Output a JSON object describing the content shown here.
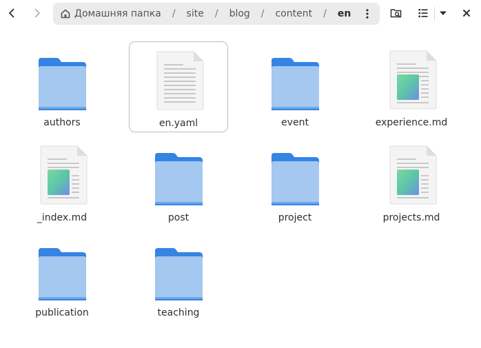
{
  "window": {
    "title": "en"
  },
  "header": {
    "back_icon": "go-previous-icon",
    "forward_icon": "go-next-icon",
    "breadcrumbs": [
      {
        "label": "Домашняя папка",
        "icon": "home-icon"
      },
      {
        "label": "site"
      },
      {
        "label": "blog"
      },
      {
        "label": "content"
      },
      {
        "label": "en"
      }
    ],
    "separator": "/",
    "path_menu_icon": "vertical-ellipsis-icon",
    "search_icon": "folder-search-icon",
    "view_icon": "list-view-icon",
    "view_menu_icon": "pan-down-icon",
    "close_icon": "close-icon"
  },
  "colors": {
    "folder_back": "#3584e4",
    "folder_front": "#a4c8f0",
    "pathbar_bg": "#ebebeb",
    "selection_border": "#bdbdbd"
  },
  "items": [
    {
      "label": "authors",
      "kind": "folder",
      "icon": "folder-icon"
    },
    {
      "label": "en.yaml",
      "kind": "text",
      "icon": "text-file-icon",
      "selected": true
    },
    {
      "label": "event",
      "kind": "folder",
      "icon": "folder-icon"
    },
    {
      "label": "experience.md",
      "kind": "markdown",
      "icon": "markdown-file-icon"
    },
    {
      "label": "_index.md",
      "kind": "markdown",
      "icon": "markdown-file-icon"
    },
    {
      "label": "post",
      "kind": "folder",
      "icon": "folder-icon"
    },
    {
      "label": "project",
      "kind": "folder",
      "icon": "folder-icon"
    },
    {
      "label": "projects.md",
      "kind": "markdown",
      "icon": "markdown-file-icon"
    },
    {
      "label": "publication",
      "kind": "folder",
      "icon": "folder-icon"
    },
    {
      "label": "teaching",
      "kind": "folder",
      "icon": "folder-icon"
    }
  ]
}
